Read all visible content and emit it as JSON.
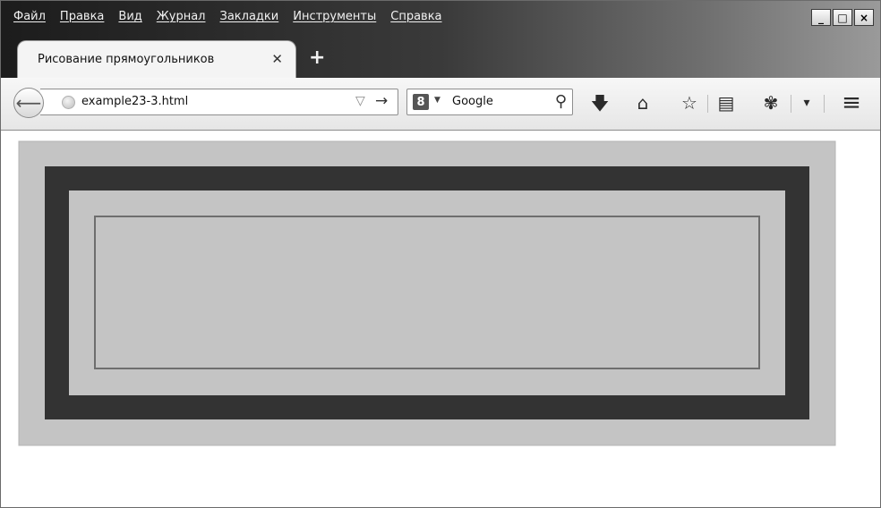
{
  "menu": {
    "items": [
      "Файл",
      "Правка",
      "Вид",
      "Журнал",
      "Закладки",
      "Инструменты",
      "Справка"
    ]
  },
  "window_controls": {
    "minimize": "_",
    "maximize": "□",
    "close": "×"
  },
  "tab": {
    "title": "Рисование прямоугольников",
    "close_glyph": "✕",
    "new_tab_glyph": "+"
  },
  "navbar": {
    "back_glyph": "⟵",
    "url": "example23-3.html",
    "url_dropdown_glyph": "▽",
    "go_glyph": "→",
    "search_engine_letter": "8",
    "search_engine_drop": "▼",
    "search_engine": "Google",
    "search_go_glyph": "⚲",
    "icons": {
      "download": "download-icon",
      "home": "home-icon",
      "bookmark": "star-icon",
      "bookmarks_list": "bookmarks-list-icon",
      "addon": "addon-icon",
      "menu": "hamburger-menu-icon"
    },
    "glyphs": {
      "download": "🡇",
      "home": "⌂",
      "bookmark": "☆",
      "bookmarks_list": "▤",
      "addon": "✾",
      "dropdown": "▾",
      "menu": "≡"
    }
  },
  "page": {
    "canvas_bg": "#c4c4c4",
    "outer_rect_color": "#333333",
    "middle_rect_color": "#c4c4c4",
    "inner_rect_stroke": "#6e6e6e"
  }
}
